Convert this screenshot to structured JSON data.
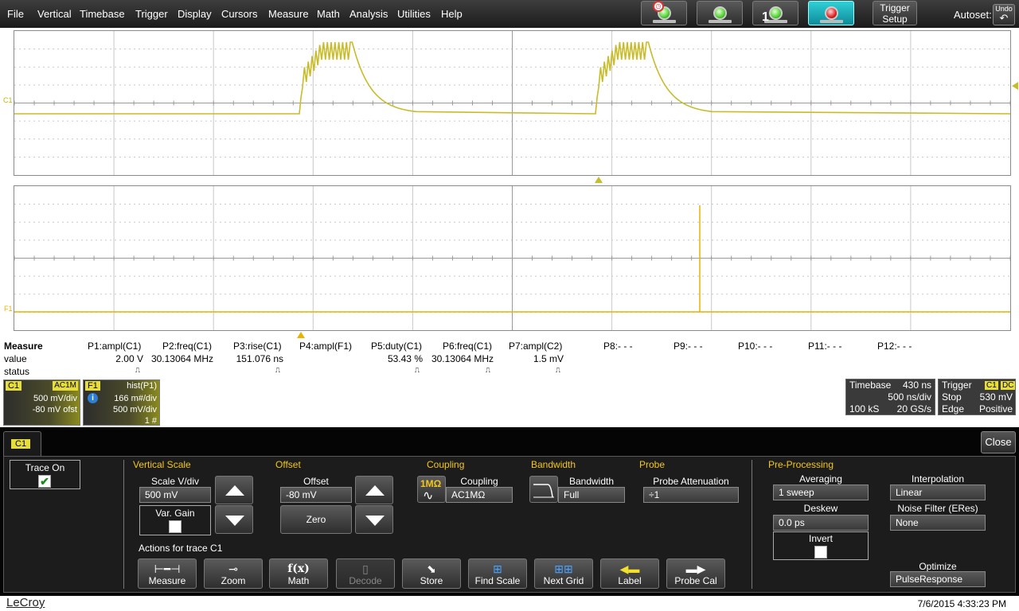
{
  "menu": {
    "items": [
      "File",
      "Vertical",
      "Timebase",
      "Trigger",
      "Display",
      "Cursors",
      "Measure",
      "Math",
      "Analysis",
      "Utilities",
      "Help"
    ],
    "trigger_setup": "Trigger Setup",
    "autoset": "Autoset",
    "undo": "Undo",
    "single_count": "1"
  },
  "grid_upper": {
    "label": "C1",
    "trace_color": "#c8bc2a"
  },
  "grid_lower": {
    "label": "F1",
    "trace_color": "#e6b400"
  },
  "measure": {
    "row_labels": {
      "header": "Measure",
      "value": "value",
      "status": "status"
    },
    "params": [
      {
        "name": "P1:ampl(C1)",
        "value": "2.00 V",
        "status": "⎍"
      },
      {
        "name": "P2:freq(C1)",
        "value": "30.13064 MHz",
        "status": ""
      },
      {
        "name": "P3:rise(C1)",
        "value": "151.076 ns",
        "status": "⎍"
      },
      {
        "name": "P4:ampl(F1)",
        "value": "",
        "status": ""
      },
      {
        "name": "P5:duty(C1)",
        "value": "53.43 %",
        "status": "⎍"
      },
      {
        "name": "P6:freq(C1)",
        "value": "30.13064 MHz",
        "status": "⎍"
      },
      {
        "name": "P7:ampl(C2)",
        "value": "1.5 mV",
        "status": "⎍"
      },
      {
        "name": "P8:- - -",
        "value": "",
        "status": ""
      },
      {
        "name": "P9:- - -",
        "value": "",
        "status": ""
      },
      {
        "name": "P10:- - -",
        "value": "",
        "status": ""
      },
      {
        "name": "P11:- - -",
        "value": "",
        "status": ""
      },
      {
        "name": "P12:- - -",
        "value": "",
        "status": ""
      }
    ]
  },
  "descriptors": {
    "c1": {
      "tag": "C1",
      "coupling": "AC1M",
      "scale": "500 mV/div",
      "offset": "-80 mV ofst"
    },
    "f1": {
      "tag": "F1",
      "func": "hist(P1)",
      "scale1": "166 m#/div",
      "scale2": "500 mV/div",
      "count": "1 #"
    }
  },
  "timebase": {
    "title": "Timebase",
    "delay": "430 ns",
    "div": "500 ns/div",
    "samples": "100 kS",
    "rate": "20 GS/s"
  },
  "trigger": {
    "title": "Trigger",
    "src": "C1",
    "coupling": "DC",
    "mode": "Stop",
    "level": "530 mV",
    "type": "Edge",
    "slope": "Positive"
  },
  "panel": {
    "tab": "C1",
    "close": "Close",
    "trace_on": "Trace On",
    "vertical_scale": {
      "title": "Vertical Scale",
      "label": "Scale V/div",
      "value": "500 mV",
      "var_gain": "Var. Gain"
    },
    "offset": {
      "title": "Offset",
      "label": "Offset",
      "value": "-80 mV",
      "zero": "Zero"
    },
    "coupling": {
      "title": "Coupling",
      "label": "Coupling",
      "value": "AC1MΩ",
      "icon_text": "1MΩ"
    },
    "bandwidth": {
      "title": "Bandwidth",
      "label": "Bandwidth",
      "value": "Full"
    },
    "probe": {
      "title": "Probe",
      "label": "Probe Attenuation",
      "value": "÷1"
    },
    "actions_title": "Actions for trace C1",
    "actions": [
      "Measure",
      "Zoom",
      "Math",
      "Decode",
      "Store",
      "Find Scale",
      "Next Grid",
      "Label",
      "Probe Cal"
    ],
    "preproc": {
      "title": "Pre-Processing",
      "averaging": "Averaging",
      "averaging_value": "1 sweep",
      "interpolation": "Interpolation",
      "interpolation_value": "Linear",
      "deskew": "Deskew",
      "deskew_value": "0.0 ps",
      "noise_filter": "Noise Filter (ERes)",
      "noise_value": "None",
      "invert": "Invert",
      "optimize": "Optimize",
      "optimize_value": "PulseResponse"
    }
  },
  "footer": {
    "brand": "LeCroy",
    "datetime": "7/6/2015 4:33:23 PM"
  }
}
